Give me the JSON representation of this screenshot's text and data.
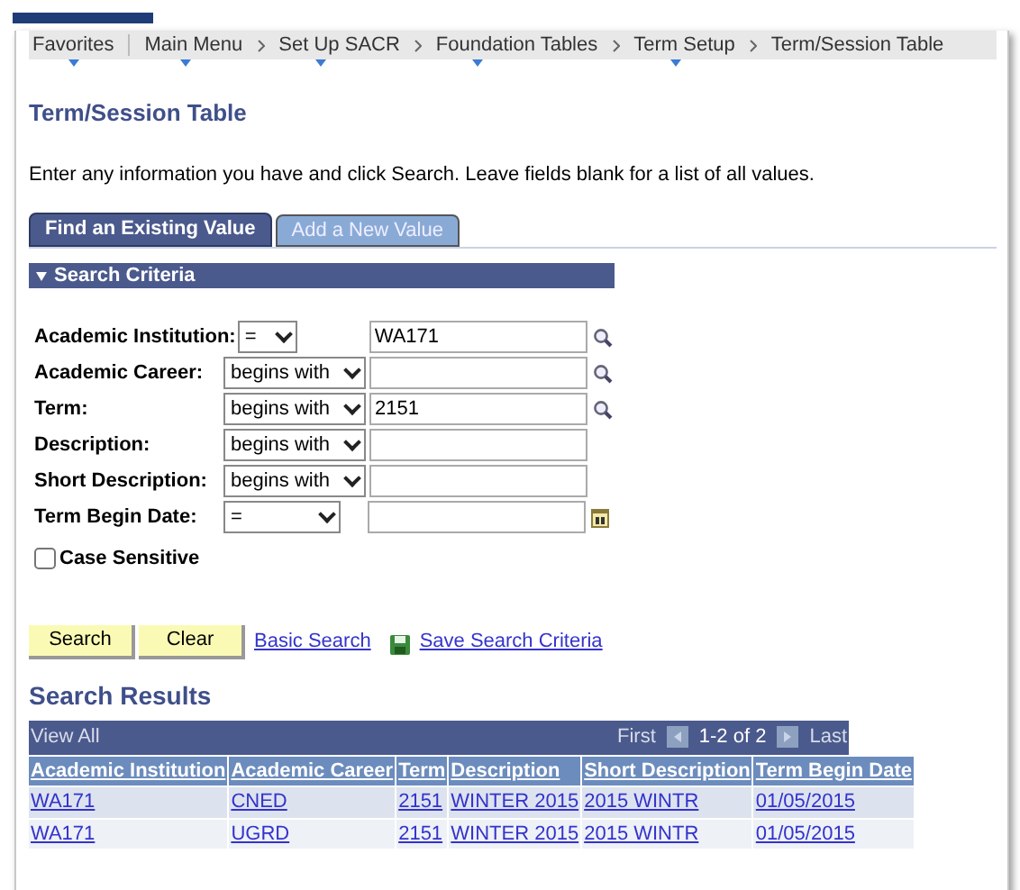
{
  "breadcrumbs": [
    {
      "label": "Favorites",
      "has_menu": true
    },
    {
      "label": "Main Menu",
      "has_menu": true
    },
    {
      "label": "Set Up SACR",
      "has_menu": true
    },
    {
      "label": "Foundation Tables",
      "has_menu": true
    },
    {
      "label": "Term Setup",
      "has_menu": true
    },
    {
      "label": "Term/Session Table",
      "has_menu": false
    }
  ],
  "page_title": "Term/Session Table",
  "instructions": "Enter any information you have and click Search. Leave fields blank for a list of all values.",
  "tabs": [
    {
      "label": "Find an Existing Value",
      "selected": true
    },
    {
      "label": "Add a New Value",
      "selected": false
    }
  ],
  "search_criteria": {
    "title": "Search Criteria",
    "expanded": true,
    "fields": [
      {
        "label": "Academic Institution:",
        "operator": "=",
        "value": "WA171",
        "kind": "lookup"
      },
      {
        "label": "Academic Career:",
        "operator": "begins with",
        "kind": "lookup"
      },
      {
        "label": "Term:",
        "operator": "begins with",
        "value": "2151",
        "kind": "lookup"
      },
      {
        "label": "Description:",
        "operator": "begins with",
        "kind": "plain"
      },
      {
        "label": "Short Description:",
        "operator": "begins with",
        "kind": "plain"
      },
      {
        "label": "Term Begin Date:",
        "operator": "=",
        "kind": "calendar"
      }
    ],
    "case_sensitive": {
      "label": "Case Sensitive",
      "checked": false
    }
  },
  "buttons": [
    "Search",
    "Clear"
  ],
  "links": [
    {
      "label": "Basic Search",
      "kind": "plain"
    },
    {
      "label": "Save Search Criteria",
      "kind": "save"
    }
  ],
  "results": {
    "title": "Search Results",
    "view_all": "View All",
    "first": "First",
    "range": "1-2 of 2",
    "last": "Last",
    "columns": [
      "Academic Institution",
      "Academic Career",
      "Term",
      "Description",
      "Short Description",
      "Term Begin Date"
    ],
    "rows": [
      [
        "WA171",
        "CNED",
        "2151",
        "WINTER 2015",
        "2015 WINTR",
        "01/05/2015"
      ],
      [
        "WA171",
        "UGRD",
        "2151",
        "WINTER 2015",
        "2015 WINTR",
        "01/05/2015"
      ]
    ]
  }
}
